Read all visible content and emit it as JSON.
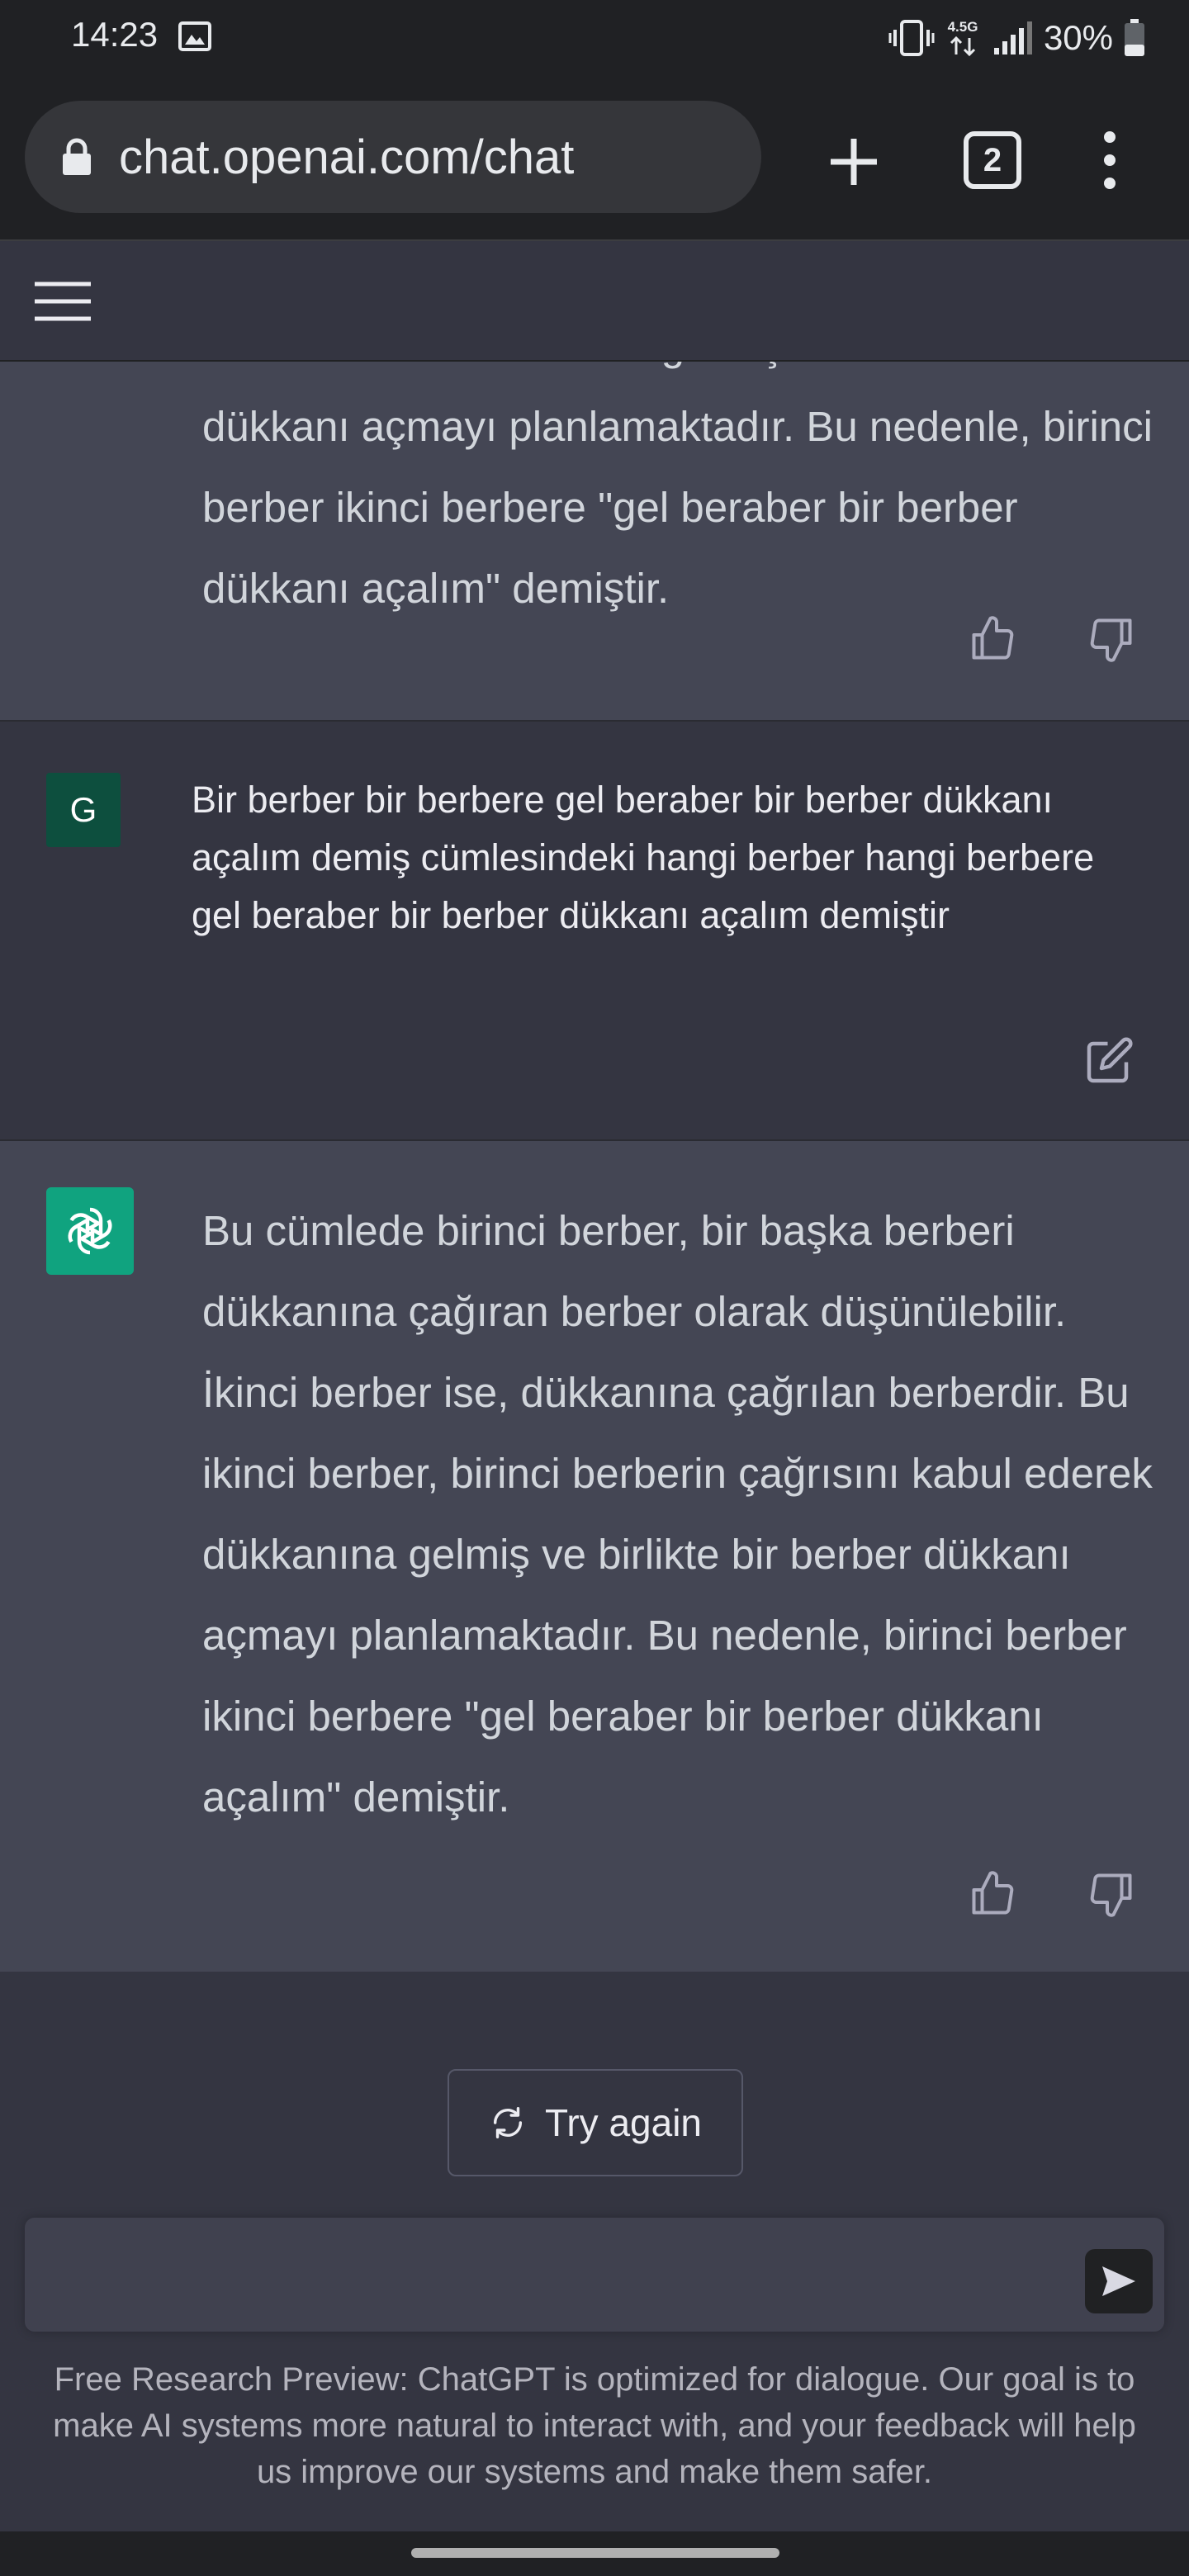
{
  "status_bar": {
    "time": "14:23",
    "network_badge": "4.5G",
    "battery": "30%",
    "icons": [
      "gallery-icon",
      "vibrate-icon",
      "network-4.5g-icon",
      "signal-icon",
      "battery-icon"
    ]
  },
  "browser": {
    "url": "chat.openai.com/chat",
    "tab_count": "2",
    "icons": [
      "lock-icon",
      "new-tab-icon",
      "tabs-icon",
      "menu-dots-icon"
    ]
  },
  "chat": {
    "previous_response": {
      "text": "kabul ederek dükkanına gelmiş ve birlikte bir berber dükkanı açmayı planlamaktadır. Bu nedenle, birinci berber ikinci berbere \"gel beraber bir berber dükkanı açalım\" demiştir."
    },
    "user_message": {
      "avatar_letter": "G",
      "text": "Bir berber bir berbere gel beraber bir berber dükkanı açalım demiş cümlesindeki hangi berber hangi berbere gel beraber bir berber dükkanı açalım demiştir"
    },
    "assistant_message": {
      "text": "Bu cümlede birinci berber, bir başka berberi dükkanına çağıran berber olarak düşünülebilir. İkinci berber ise, dükkanına çağrılan berberdir. Bu ikinci berber, birinci berberin çağrısını kabul ederek dükkanına gelmiş ve birlikte bir berber dükkanı açmayı planlamaktadır. Bu nedenle, birinci berber ikinci berbere \"gel beraber bir berber dükkanı açalım\" demiştir."
    }
  },
  "controls": {
    "try_again_label": "Try again",
    "input_value": "",
    "disclaimer": "Free Research Preview: ChatGPT is optimized for dialogue. Our goal is to make AI systems more natural to interact with, and your feedback will help us improve our systems and make them safer."
  },
  "colors": {
    "user_bg": "#343541",
    "assistant_bg": "#444654",
    "gpt_brand": "#10a37f",
    "chrome_bg": "#202124"
  }
}
